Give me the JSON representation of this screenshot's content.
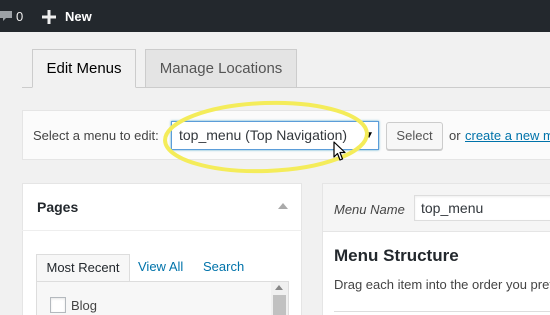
{
  "adminbar": {
    "comment_count": "0",
    "new_label": "New"
  },
  "tabs": [
    {
      "label": "Edit Menus",
      "active": true
    },
    {
      "label": "Manage Locations",
      "active": false
    }
  ],
  "manage": {
    "label": "Select a menu to edit:",
    "selected_menu": "top_menu (Top Navigation)",
    "select_button": "Select",
    "or_text": "or",
    "create_link": "create a new menu"
  },
  "pages_panel": {
    "title": "Pages",
    "tabs": [
      "Most Recent",
      "View All",
      "Search"
    ],
    "items": [
      {
        "label": "Blog",
        "checked": false
      }
    ]
  },
  "menu_panel": {
    "menu_name_label": "Menu Name",
    "menu_name_value": "top_menu",
    "structure_title": "Menu Structure",
    "structure_desc": "Drag each item into the order you prefer."
  },
  "colors": {
    "adminbar_bg": "#23282d",
    "link": "#0073aa",
    "highlight": "#f4ec5a"
  },
  "icons": [
    "comment-icon",
    "plus-icon",
    "dropdown-arrow-icon",
    "collapse-arrow-icon",
    "mouse-cursor-icon"
  ]
}
